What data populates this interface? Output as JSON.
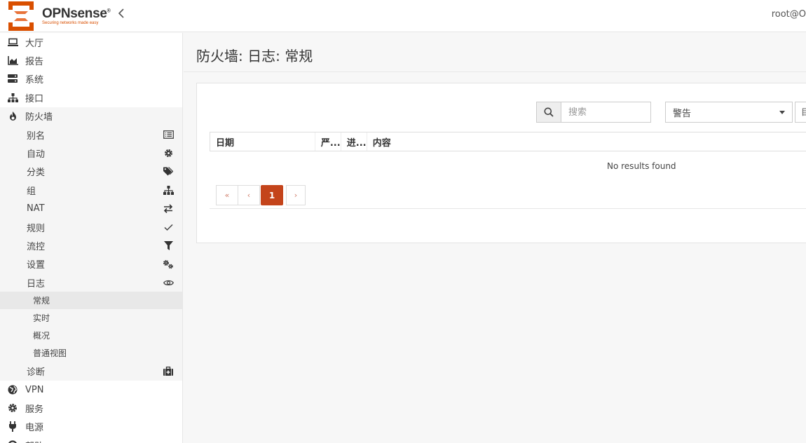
{
  "header": {
    "brand": "OPNsense",
    "brand_mark": "®",
    "tagline": "Securing networks made easy",
    "user": "root@O"
  },
  "sidebar": {
    "items_top": [
      {
        "label": "大厅",
        "icon": "laptop-icon"
      },
      {
        "label": "报告",
        "icon": "area-chart-icon"
      },
      {
        "label": "系统",
        "icon": "server-icon"
      },
      {
        "label": "接口",
        "icon": "sitemap-icon"
      },
      {
        "label": "防火墙",
        "icon": "fire-icon"
      }
    ],
    "firewall_sub": [
      {
        "label": "别名",
        "icon": "list-alt-icon"
      },
      {
        "label": "自动",
        "icon": "gear-icon"
      },
      {
        "label": "分类",
        "icon": "tags-icon"
      },
      {
        "label": "组",
        "icon": "sitemap-icon"
      },
      {
        "label": "NAT",
        "icon": "exchange-icon"
      },
      {
        "label": "规则",
        "icon": "check-icon"
      },
      {
        "label": "流控",
        "icon": "filter-icon"
      },
      {
        "label": "设置",
        "icon": "gears-icon"
      },
      {
        "label": "日志",
        "icon": "eye-icon"
      }
    ],
    "log_sub": [
      {
        "label": "常规"
      },
      {
        "label": "实时"
      },
      {
        "label": "概况"
      },
      {
        "label": "普通视图"
      }
    ],
    "diag": {
      "label": "诊断",
      "icon": "medkit-icon"
    },
    "items_bottom": [
      {
        "label": "VPN",
        "icon": "globe-icon"
      },
      {
        "label": "服务",
        "icon": "gear-icon"
      },
      {
        "label": "电源",
        "icon": "plug-icon"
      },
      {
        "label": "帮助",
        "icon": "support-icon"
      }
    ]
  },
  "main": {
    "title": "防火墙: 日志: 常规",
    "search_placeholder": "搜索",
    "level_selected": "警告",
    "extra_button": "目",
    "columns": [
      "日期",
      "严...",
      "进...",
      "内容"
    ],
    "empty_text": "No results found",
    "pager": {
      "first": "«",
      "prev": "‹",
      "current": "1",
      "next": "›"
    }
  },
  "colors": {
    "accent": "#c4441b",
    "brand_orange": "#d94f00"
  }
}
